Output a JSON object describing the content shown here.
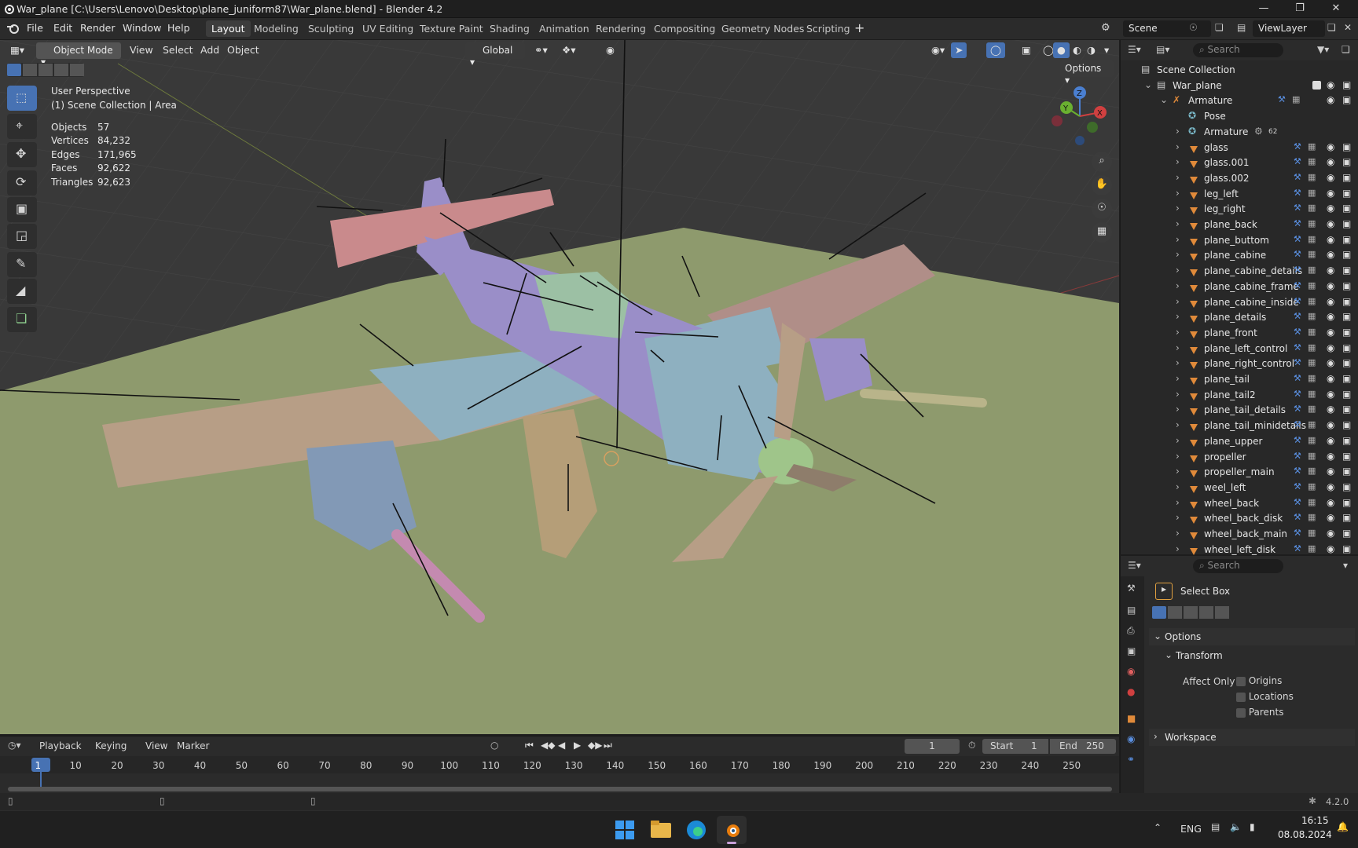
{
  "window": {
    "title": "War_plane [C:\\Users\\Lenovo\\Desktop\\plane_juniform87\\War_plane.blend] - Blender 4.2"
  },
  "menu": [
    "File",
    "Edit",
    "Render",
    "Window",
    "Help"
  ],
  "workspaces": [
    "Layout",
    "Modeling",
    "Sculpting",
    "UV Editing",
    "Texture Paint",
    "Shading",
    "Animation",
    "Rendering",
    "Compositing",
    "Geometry Nodes",
    "Scripting"
  ],
  "active_workspace": "Layout",
  "scene": {
    "label": "Scene",
    "view_layer": "ViewLayer"
  },
  "viewport_header": {
    "mode": "Object Mode",
    "menus": [
      "View",
      "Select",
      "Add",
      "Object"
    ],
    "orientation": "Global",
    "options": "Options"
  },
  "viewport_info": {
    "perspective": "User Perspective",
    "collection": "(1) Scene Collection | Area",
    "stats": [
      {
        "label": "Objects",
        "value": "57"
      },
      {
        "label": "Vertices",
        "value": "84,232"
      },
      {
        "label": "Edges",
        "value": "171,965"
      },
      {
        "label": "Faces",
        "value": "92,622"
      },
      {
        "label": "Triangles",
        "value": "92,623"
      }
    ]
  },
  "gizmo": {
    "x": "X",
    "y": "Y",
    "z": "Z"
  },
  "outliner": {
    "search_placeholder": "Search",
    "root": "Scene Collection",
    "collection": "War_plane",
    "armature": "Armature",
    "pose": "Pose",
    "armature_data": "Armature",
    "armature_count": "62",
    "objects": [
      "glass",
      "glass.001",
      "glass.002",
      "leg_left",
      "leg_right",
      "plane_back",
      "plane_buttom",
      "plane_cabine",
      "plane_cabine_details",
      "plane_cabine_frame",
      "plane_cabine_inside",
      "plane_details",
      "plane_front",
      "plane_left_control",
      "plane_right_control",
      "plane_tail",
      "plane_tail2",
      "plane_tail_details",
      "plane_tail_minidetails",
      "plane_upper",
      "propeller",
      "propeller_main",
      "weel_left",
      "wheel_back",
      "wheel_back_disk",
      "wheel_back_main",
      "wheel_left_disk"
    ]
  },
  "properties": {
    "search_placeholder": "Search",
    "tool": "Select Box",
    "options": "Options",
    "transform": "Transform",
    "affect_only": "Affect Only",
    "checks": [
      "Origins",
      "Locations",
      "Parents"
    ],
    "workspace": "Workspace"
  },
  "timeline": {
    "menus": [
      "Playback",
      "Keying",
      "View",
      "Marker"
    ],
    "current_frame": "1",
    "start_label": "Start",
    "start": "1",
    "end_label": "End",
    "end": "250",
    "ticks": [
      "1",
      "10",
      "20",
      "30",
      "40",
      "50",
      "60",
      "70",
      "80",
      "90",
      "100",
      "110",
      "120",
      "130",
      "140",
      "150",
      "160",
      "170",
      "180",
      "190",
      "200",
      "210",
      "220",
      "230",
      "240",
      "250"
    ]
  },
  "status": {
    "version": "4.2.0"
  },
  "taskbar": {
    "lang": "ENG",
    "time": "16:15",
    "date": "08.08.2024"
  }
}
